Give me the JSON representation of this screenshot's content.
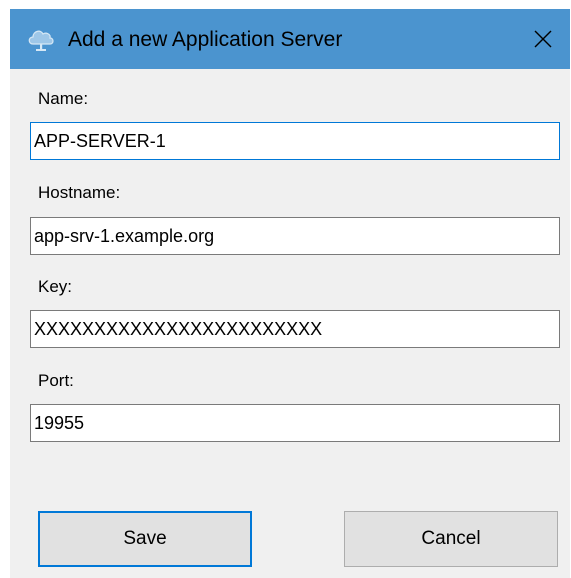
{
  "window": {
    "title": "Add a new Application Server",
    "icon": "cloud-icon",
    "accent_color": "#4b94cf"
  },
  "form": {
    "name": {
      "label": "Name:",
      "value": "APP-SERVER-1"
    },
    "hostname": {
      "label": "Hostname:",
      "value": "app-srv-1.example.org"
    },
    "key": {
      "label": "Key:",
      "value": "XXXXXXXXXXXXXXXXXXXXXXXX"
    },
    "port": {
      "label": "Port:",
      "value": "19955"
    }
  },
  "buttons": {
    "save_label": "Save",
    "cancel_label": "Cancel"
  }
}
